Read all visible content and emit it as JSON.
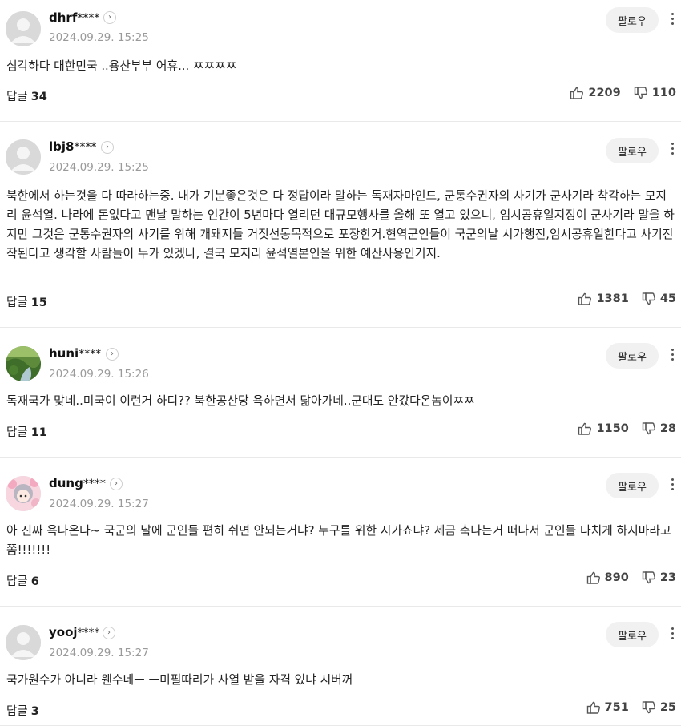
{
  "comments": [
    {
      "username": "dhrf",
      "mask": "****",
      "date": "2024.09.29. 15:25",
      "follow_label": "팔로우",
      "text": "심각하다 대한민국 ..용산부부 어휴... ㅉㅉㅉㅉ",
      "reply_label": "답글",
      "reply_count": "34",
      "likes": "2209",
      "dislikes": "110",
      "avatar": "default-avatar"
    },
    {
      "username": "lbj8",
      "mask": "****",
      "date": "2024.09.29. 15:25",
      "follow_label": "팔로우",
      "text": "북한에서 하는것을 다 따라하는중. 내가 기분좋은것은 다 정답이라 말하는 독재자마인드, 군통수권자의 사기가 군사기라 착각하는 모지리 윤석열. 나라에 돈없다고 맨날 말하는 인간이 5년마다 열리던 대규모행사를 올해 또 열고 있으니, 임시공휴일지정이 군사기라 말을 하지만 그것은 군통수권자의 사기를 위해 개돼지들 거짓선동목적으로 포장한거.현역군인들이 국군의날 시가행진,임시공휴일한다고 사기진작된다고 생각할 사람들이 누가 있겠나, 결국 모지리 윤석열본인을 위한 예산사용인거지.",
      "reply_label": "답글",
      "reply_count": "15",
      "likes": "1381",
      "dislikes": "45",
      "avatar": "default-avatar"
    },
    {
      "username": "huni",
      "mask": "****",
      "date": "2024.09.29. 15:26",
      "follow_label": "팔로우",
      "text": "독재국가 맞네..미국이 이런거 하디?? 북한공산당 욕하면서 닮아가네..군대도 안갔다온놈이ㅉㅉ",
      "reply_label": "답글",
      "reply_count": "11",
      "likes": "1150",
      "dislikes": "28",
      "avatar": "nature-photo-avatar"
    },
    {
      "username": "dung",
      "mask": "****",
      "date": "2024.09.29. 15:27",
      "follow_label": "팔로우",
      "text": "아 진짜 욕나온다~ 국군의 날에 군인들 편히 쉬면 안되는거냐? 누구를 위한 시가쇼냐? 세금 축나는거 떠나서 군인들 다치게 하지마라고 쫌!!!!!!!",
      "reply_label": "답글",
      "reply_count": "6",
      "likes": "890",
      "dislikes": "23",
      "avatar": "anime-character-avatar"
    },
    {
      "username": "yooj",
      "mask": "****",
      "date": "2024.09.29. 15:27",
      "follow_label": "팔로우",
      "text": "국가원수가 아니라 웬수네ㅡ ㅡ미필따리가 사열 받을 자격 있냐 시버꺼",
      "reply_label": "답글",
      "reply_count": "3",
      "likes": "751",
      "dislikes": "25",
      "avatar": "default-avatar"
    }
  ],
  "icons": {
    "profile_arrow": "chevron-right-icon",
    "more": "more-vertical-icon",
    "like": "thumbs-up-icon",
    "dislike": "thumbs-down-icon"
  },
  "colors": {
    "date": "#9a9a9a",
    "follow_bg": "#f1f1f1",
    "divider": "#e9e9e9"
  }
}
